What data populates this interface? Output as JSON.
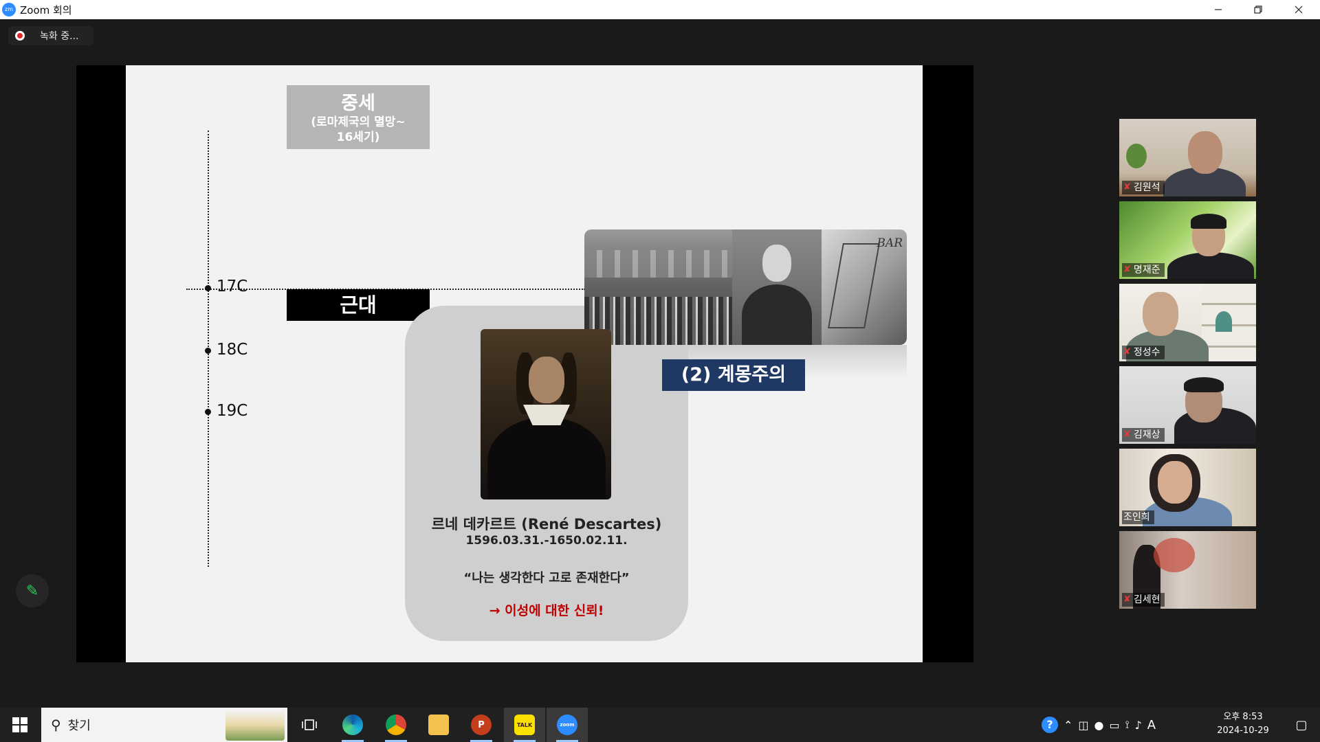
{
  "window": {
    "title": "Zoom 회의",
    "logo_text": "zm"
  },
  "recording": {
    "label": "녹화 중..."
  },
  "slide": {
    "medieval_title": "중세",
    "medieval_sub": "(로마제국의 멸망~\n16세기)",
    "modern_title": "근대",
    "timeline": [
      "17C",
      "18C",
      "19C"
    ],
    "enlightenment_label": "(2) 계몽주의",
    "enlightenment_image_text": "BAR",
    "descartes_name": "르네 데카르트 (René Descartes)",
    "descartes_dates": "1596.03.31.-1650.02.11.",
    "descartes_quote": "“나는 생각한다 고로 존재한다”",
    "descartes_reason": "→ 이성에 대한 신뢰!"
  },
  "participants": [
    {
      "name": "김원석",
      "muted": true
    },
    {
      "name": "명재준",
      "muted": true
    },
    {
      "name": "정성수",
      "muted": true
    },
    {
      "name": "김재상",
      "muted": true
    },
    {
      "name": "조인희",
      "muted": false,
      "speaking": true
    },
    {
      "name": "김세현",
      "muted": true
    }
  ],
  "taskbar": {
    "search_placeholder": "찾기",
    "apps": [
      {
        "icon": "task-view-icon",
        "label": ""
      },
      {
        "icon": "edge-icon",
        "label": ""
      },
      {
        "icon": "chrome-icon",
        "label": ""
      },
      {
        "icon": "file-explorer-icon",
        "label": ""
      },
      {
        "icon": "powerpoint-icon",
        "label": "P"
      },
      {
        "icon": "kakaotalk-icon",
        "label": "TALK"
      },
      {
        "icon": "zoom-icon",
        "label": "zoom"
      }
    ],
    "ime": "A",
    "time": "오후 8:53",
    "date": "2024-10-29"
  },
  "colors": {
    "speaking_outline": "#d6e94b",
    "enlightenment_label_bg": "#1f3864",
    "reason_text": "#c00000",
    "annotate_pen": "#34c759"
  }
}
